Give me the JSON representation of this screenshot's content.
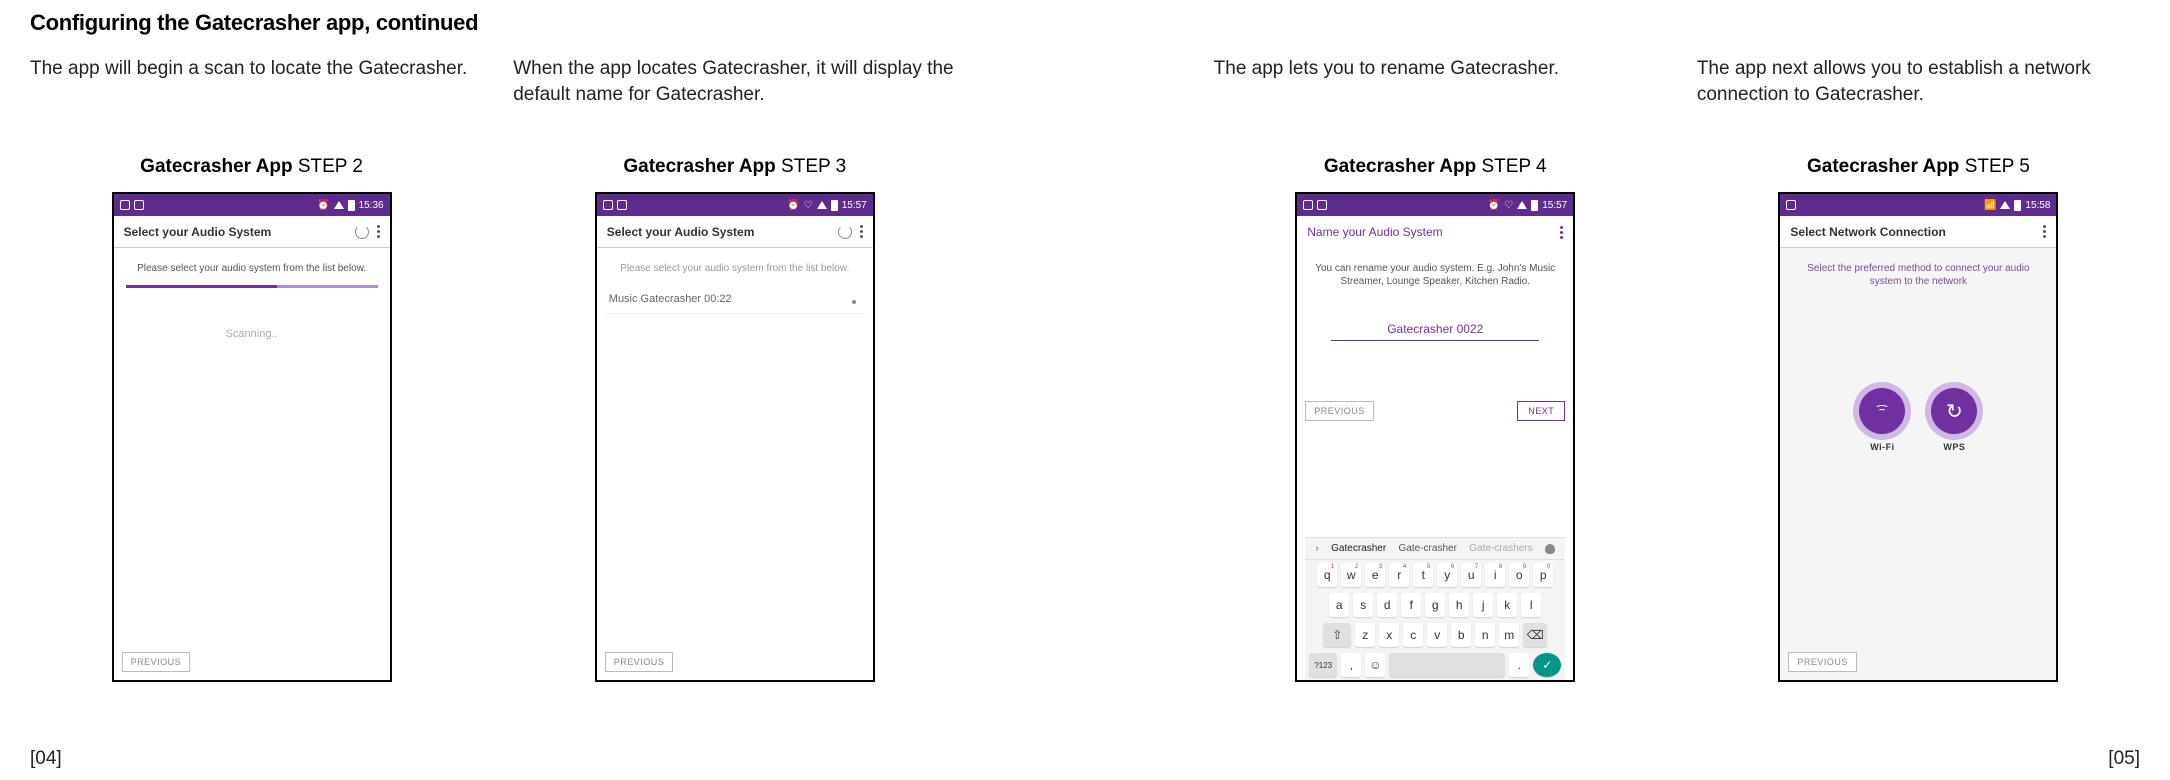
{
  "page_title": "Configuring the Gatecrasher app, continued",
  "page_left_num": "[04]",
  "page_right_num": "[05]",
  "steps": [
    {
      "desc": "The app will begin a scan to locate the Gatecrasher.",
      "label_bold": "Gatecrasher App ",
      "label_rest": "STEP 2",
      "status_time": "15:36",
      "appbar_title": "Select your Audio System",
      "hint": "Please select your audio system from the list below.",
      "scanning": "Scanning..",
      "prev": "PREVIOUS"
    },
    {
      "desc": "When the app locates Gatecrasher, it will display the default name for Gatecrasher.",
      "label_bold": "Gatecrasher App ",
      "label_rest": "STEP 3",
      "status_time": "15:57",
      "appbar_title": "Select your Audio System",
      "hint": "Please select your audio system from the list below.",
      "device": "Music Gatecrasher 00:22",
      "prev": "PREVIOUS"
    },
    {
      "desc": "The app lets you to rename Gatecrasher.",
      "label_bold": "Gatecrasher App ",
      "label_rest": "STEP 4",
      "status_time": "15:57",
      "appbar_title": "Name your Audio System",
      "hint": "You can rename your audio system. E.g. John's Music Streamer, Lounge Speaker, Kitchen Radio.",
      "input_value": "Gatecrasher 0022",
      "prev": "PREVIOUS",
      "next": "NEXT",
      "suggest1": "Gatecrasher",
      "suggest2": "Gate-crasher",
      "suggest3": "Gate-crashers",
      "row1": [
        "q",
        "w",
        "e",
        "r",
        "t",
        "y",
        "u",
        "i",
        "o",
        "p"
      ],
      "row1sup": [
        "1",
        "2",
        "3",
        "4",
        "5",
        "6",
        "7",
        "8",
        "9",
        "0"
      ],
      "row2": [
        "a",
        "s",
        "d",
        "f",
        "g",
        "h",
        "j",
        "k",
        "l"
      ],
      "row3": [
        "z",
        "x",
        "c",
        "v",
        "b",
        "n",
        "m"
      ],
      "sym": "?123"
    },
    {
      "desc": "The app next allows you to establish a network connection to Gatecrasher.",
      "label_bold": "Gatecrasher App ",
      "label_rest": "STEP 5",
      "status_time": "15:58",
      "appbar_title": "Select Network Connection",
      "hint": "Select the preferred method to connect your audio system to the network",
      "wifi_label": "Wi-Fi",
      "wps_label": "WPS",
      "prev": "PREVIOUS"
    }
  ]
}
